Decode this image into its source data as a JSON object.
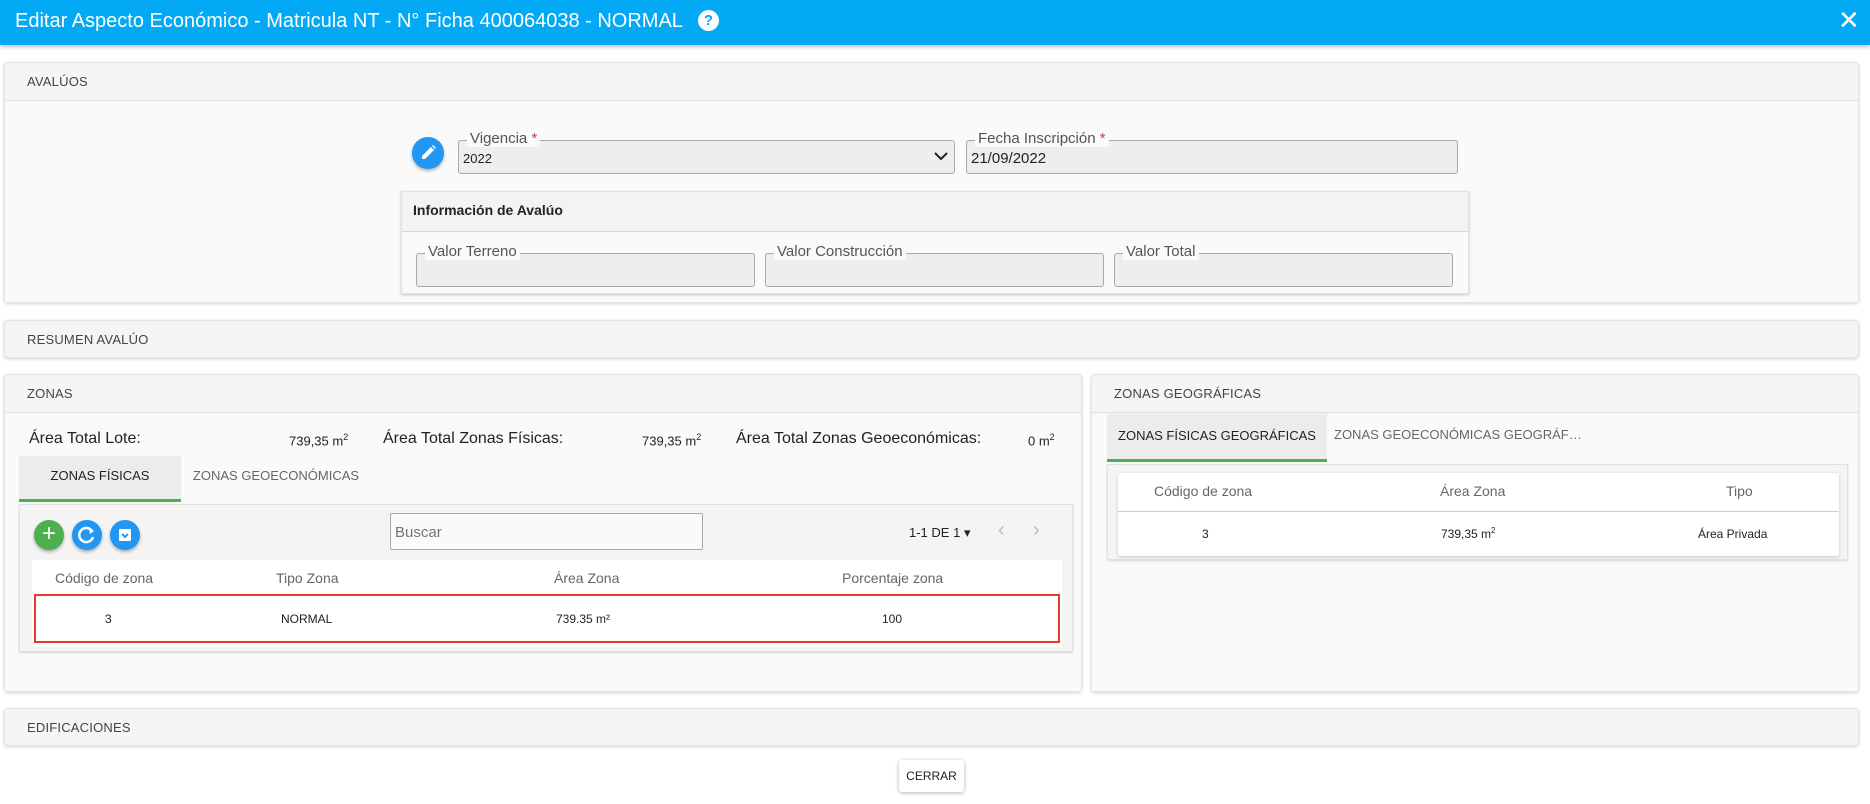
{
  "dialog": {
    "title": "Editar Aspecto Económico - Matricula NT - N° Ficha 400064038 - NORMAL",
    "help_label": "?",
    "close_glyph": "✕"
  },
  "avaluos": {
    "header": "AVALÚOS",
    "vigencia": {
      "label": "Vigencia",
      "required": "*",
      "value": "2022"
    },
    "fecha": {
      "label": "Fecha Inscripción",
      "required": "*",
      "value": "21/09/2022"
    },
    "info": {
      "title": "Información de Avalúo",
      "valor_terreno": {
        "label": "Valor Terreno",
        "value": ""
      },
      "valor_construccion": {
        "label": "Valor Construcción",
        "value": ""
      },
      "valor_total": {
        "label": "Valor Total",
        "value": ""
      }
    }
  },
  "resumen": {
    "header": "RESUMEN AVALÚO"
  },
  "zonas": {
    "header": "ZONAS",
    "area_total_lote": {
      "label": "Área Total Lote:",
      "value": "739,35 m",
      "sup": "2"
    },
    "area_total_fisicas": {
      "label": "Área Total Zonas Físicas:",
      "value": "739,35 m",
      "sup": "2"
    },
    "area_total_geoeconomicas": {
      "label": "Área Total Zonas Geoeconómicas:",
      "value": "0 m",
      "sup": "2"
    },
    "tabs": [
      {
        "label": "ZONAS FÍSICAS",
        "active": true
      },
      {
        "label": "ZONAS GEOECONÓMICAS",
        "active": false
      }
    ],
    "search_placeholder": "Buscar",
    "pagination": {
      "label": "1-1 DE 1",
      "caret": "▾",
      "prev": "‹",
      "next": "›"
    },
    "columns": [
      "Código de zona",
      "Tipo Zona",
      "Área Zona",
      "Porcentaje zona"
    ],
    "rows": [
      {
        "codigo": "3",
        "tipo": "NORMAL",
        "area": "739.35 m²",
        "porcentaje": "100"
      }
    ],
    "highlight_color": "#e53935"
  },
  "zonas_geograficas": {
    "header": "ZONAS GEOGRÁFICAS",
    "tabs": [
      {
        "label": "ZONAS FÍSICAS GEOGRÁFICAS",
        "active": true
      },
      {
        "label": "ZONAS GEOECONÓMICAS GEOGRÁF…",
        "active": false
      }
    ],
    "columns": [
      "Código de zona",
      "Área Zona",
      "Tipo"
    ],
    "rows": [
      {
        "codigo": "3",
        "area": "739,35 m",
        "area_sup": "2",
        "tipo": "Área Privada"
      }
    ]
  },
  "edificaciones": {
    "header": "EDIFICACIONES"
  },
  "footer": {
    "close_label": "CERRAR"
  },
  "colors": {
    "titlebar": "#03a9f4",
    "tab_active": "#4caf50",
    "add": "#4caf50",
    "action_blue": "#2196f3"
  }
}
